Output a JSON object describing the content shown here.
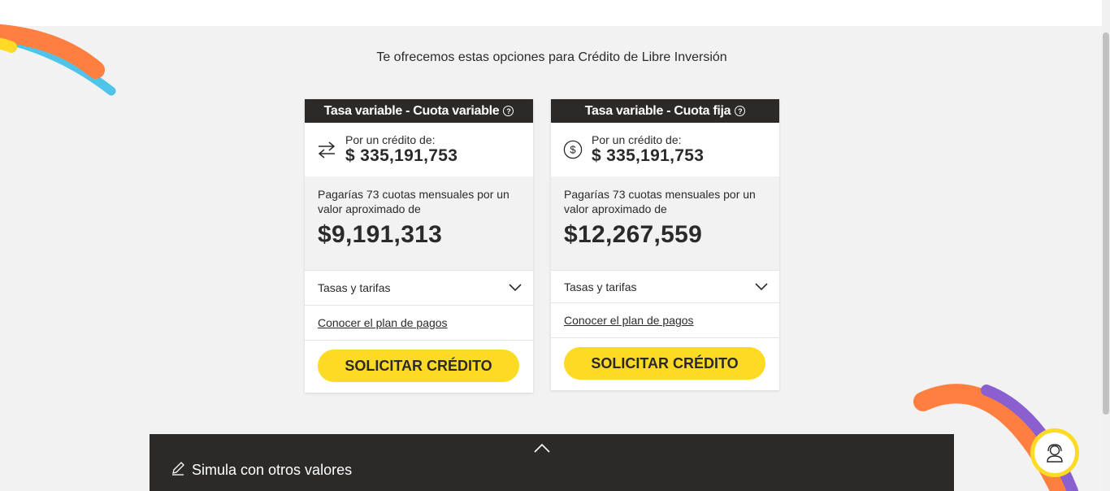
{
  "intro": "Te ofrecemos estas opciones para Crédito de Libre Inversión",
  "help_glyph": "?",
  "colors": {
    "accent": "#fdda24",
    "dark": "#2c2a29",
    "background": "#f2f2f2"
  },
  "cards": [
    {
      "title": "Tasa variable - Cuota variable",
      "icon": "exchange-arrows-icon",
      "amount_label": "Por un crédito de:",
      "amount_value": "$ 335,191,753",
      "quota_text": "Pagarías 73 cuotas mensuales por un valor aproximado de",
      "quota_value": "$9,191,313",
      "tasas_label": "Tasas y tarifas",
      "plan_link": "Conocer el plan de pagos",
      "button_label": "SOLICITAR CRÉDITO"
    },
    {
      "title": "Tasa variable - Cuota fija",
      "icon": "dollar-circle-icon",
      "amount_label": "Por un crédito de:",
      "amount_value": "$ 335,191,753",
      "quota_text": "Pagarías 73 cuotas mensuales por un valor aproximado de",
      "quota_value": "$12,267,559",
      "tasas_label": "Tasas y tarifas",
      "plan_link": "Conocer el plan de pagos",
      "button_label": "SOLICITAR CRÉDITO"
    }
  ],
  "footer": {
    "label": "Simula con otros valores",
    "icon": "pencil-icon",
    "expand_icon": "chevron-up-icon"
  },
  "chat": {
    "icon": "chat-agent-icon"
  }
}
